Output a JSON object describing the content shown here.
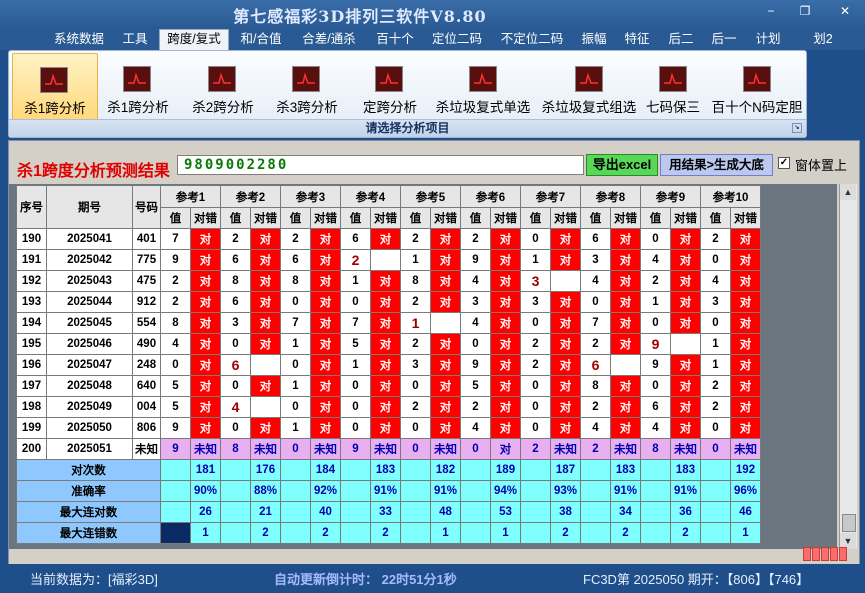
{
  "app_title": "第七感福彩3D排列三软件V8.80",
  "window_controls": [
    "−",
    "❐",
    "✕"
  ],
  "menu": [
    "系统数据",
    "工具",
    "跨度/复式",
    "和/合值",
    "合差/通杀",
    "百十个",
    "定位二码",
    "不定位二码",
    "振幅",
    "特征",
    "后二",
    "后一",
    "计划",
    "划2"
  ],
  "menu_active_index": 2,
  "ribbon": {
    "buttons": [
      "杀1跨分析",
      "杀1跨分析",
      "杀2跨分析",
      "杀3跨分析",
      "定跨分析",
      "杀垃圾复式单选",
      "杀垃圾复式组选",
      "七码保三",
      "百十个N码定胆"
    ],
    "selected_index": 0,
    "footer": "请选择分析项目"
  },
  "panel": {
    "result_title": "杀1跨度分析预测结果",
    "result_value": "9809002280",
    "export_label": "导出excel",
    "generate_label": "用结果>生成大底",
    "topmost_checked": "✓",
    "topmost_label": "窗体置上"
  },
  "grid": {
    "col_seq": "序号",
    "col_period": "期号",
    "col_number": "号码",
    "ref_groups": [
      "参考1",
      "参考2",
      "参考3",
      "参考4",
      "参考5",
      "参考6",
      "参考7",
      "参考8",
      "参考9",
      "参考10"
    ],
    "sub_value": "值",
    "sub_result": "对错",
    "rows": [
      {
        "seq": "190",
        "period": "2025041",
        "num": "401",
        "cells": [
          [
            "7",
            "对"
          ],
          [
            "2",
            "对"
          ],
          [
            "2",
            "对"
          ],
          [
            "6",
            "对"
          ],
          [
            "2",
            "对"
          ],
          [
            "2",
            "对"
          ],
          [
            "0",
            "对"
          ],
          [
            "6",
            "对"
          ],
          [
            "0",
            "对"
          ],
          [
            "2",
            "对"
          ]
        ]
      },
      {
        "seq": "191",
        "period": "2025042",
        "num": "775",
        "cells": [
          [
            "9",
            "对"
          ],
          [
            "6",
            "对"
          ],
          [
            "6",
            "对"
          ],
          [
            "2",
            ""
          ],
          [
            "1",
            "对"
          ],
          [
            "9",
            "对"
          ],
          [
            "1",
            "对"
          ],
          [
            "3",
            "对"
          ],
          [
            "4",
            "对"
          ],
          [
            "0",
            "对"
          ]
        ]
      },
      {
        "seq": "192",
        "period": "2025043",
        "num": "475",
        "cells": [
          [
            "2",
            "对"
          ],
          [
            "8",
            "对"
          ],
          [
            "8",
            "对"
          ],
          [
            "1",
            "对"
          ],
          [
            "8",
            "对"
          ],
          [
            "4",
            "对"
          ],
          [
            "3",
            ""
          ],
          [
            "4",
            "对"
          ],
          [
            "2",
            "对"
          ],
          [
            "4",
            "对"
          ]
        ]
      },
      {
        "seq": "193",
        "period": "2025044",
        "num": "912",
        "cells": [
          [
            "2",
            "对"
          ],
          [
            "6",
            "对"
          ],
          [
            "0",
            "对"
          ],
          [
            "0",
            "对"
          ],
          [
            "2",
            "对"
          ],
          [
            "3",
            "对"
          ],
          [
            "3",
            "对"
          ],
          [
            "0",
            "对"
          ],
          [
            "1",
            "对"
          ],
          [
            "3",
            "对"
          ]
        ]
      },
      {
        "seq": "194",
        "period": "2025045",
        "num": "554",
        "cells": [
          [
            "8",
            "对"
          ],
          [
            "3",
            "对"
          ],
          [
            "7",
            "对"
          ],
          [
            "7",
            "对"
          ],
          [
            "1",
            ""
          ],
          [
            "4",
            "对"
          ],
          [
            "0",
            "对"
          ],
          [
            "7",
            "对"
          ],
          [
            "0",
            "对"
          ],
          [
            "0",
            "对"
          ]
        ]
      },
      {
        "seq": "195",
        "period": "2025046",
        "num": "490",
        "cells": [
          [
            "4",
            "对"
          ],
          [
            "0",
            "对"
          ],
          [
            "1",
            "对"
          ],
          [
            "5",
            "对"
          ],
          [
            "2",
            "对"
          ],
          [
            "0",
            "对"
          ],
          [
            "2",
            "对"
          ],
          [
            "2",
            "对"
          ],
          [
            "9",
            ""
          ],
          [
            "1",
            "对"
          ]
        ]
      },
      {
        "seq": "196",
        "period": "2025047",
        "num": "248",
        "cells": [
          [
            "0",
            "对"
          ],
          [
            "6",
            ""
          ],
          [
            "0",
            "对"
          ],
          [
            "1",
            "对"
          ],
          [
            "3",
            "对"
          ],
          [
            "9",
            "对"
          ],
          [
            "2",
            "对"
          ],
          [
            "6",
            ""
          ],
          [
            "9",
            "对"
          ],
          [
            "1",
            "对"
          ]
        ]
      },
      {
        "seq": "197",
        "period": "2025048",
        "num": "640",
        "cells": [
          [
            "5",
            "对"
          ],
          [
            "0",
            "对"
          ],
          [
            "1",
            "对"
          ],
          [
            "0",
            "对"
          ],
          [
            "0",
            "对"
          ],
          [
            "5",
            "对"
          ],
          [
            "0",
            "对"
          ],
          [
            "8",
            "对"
          ],
          [
            "0",
            "对"
          ],
          [
            "2",
            "对"
          ]
        ]
      },
      {
        "seq": "198",
        "period": "2025049",
        "num": "004",
        "cells": [
          [
            "5",
            "对"
          ],
          [
            "4",
            ""
          ],
          [
            "0",
            "对"
          ],
          [
            "0",
            "对"
          ],
          [
            "2",
            "对"
          ],
          [
            "2",
            "对"
          ],
          [
            "0",
            "对"
          ],
          [
            "2",
            "对"
          ],
          [
            "6",
            "对"
          ],
          [
            "2",
            "对"
          ]
        ]
      },
      {
        "seq": "199",
        "period": "2025050",
        "num": "806",
        "cells": [
          [
            "9",
            "对"
          ],
          [
            "0",
            "对"
          ],
          [
            "1",
            "对"
          ],
          [
            "0",
            "对"
          ],
          [
            "0",
            "对"
          ],
          [
            "4",
            "对"
          ],
          [
            "0",
            "对"
          ],
          [
            "4",
            "对"
          ],
          [
            "4",
            "对"
          ],
          [
            "0",
            "对"
          ]
        ]
      }
    ],
    "miss_marks": [
      [
        1,
        3
      ],
      [
        2,
        6
      ],
      [
        4,
        4
      ],
      [
        5,
        8
      ],
      [
        6,
        1
      ],
      [
        6,
        7
      ],
      [
        8,
        1
      ]
    ],
    "unknown_row": {
      "seq": "200",
      "period": "2025051",
      "num": "未知",
      "cells": [
        [
          "9",
          "未知"
        ],
        [
          "8",
          "未知"
        ],
        [
          "0",
          "未知"
        ],
        [
          "9",
          "未知"
        ],
        [
          "0",
          "未知"
        ],
        [
          "0",
          "对"
        ],
        [
          "2",
          "未知"
        ],
        [
          "2",
          "未知"
        ],
        [
          "8",
          "未知"
        ],
        [
          "0",
          "未知"
        ]
      ]
    },
    "stats": [
      {
        "label": "对次数",
        "values": [
          "181",
          "176",
          "184",
          "183",
          "182",
          "189",
          "187",
          "183",
          "183",
          "192"
        ]
      },
      {
        "label": "准确率",
        "values": [
          "90%",
          "88%",
          "92%",
          "91%",
          "91%",
          "94%",
          "93%",
          "91%",
          "91%",
          "96%"
        ]
      },
      {
        "label": "最大连对数",
        "values": [
          "26",
          "21",
          "40",
          "33",
          "48",
          "53",
          "38",
          "34",
          "36",
          "46"
        ]
      },
      {
        "label": "最大连错数",
        "values": [
          "1",
          "2",
          "2",
          "2",
          "1",
          "1",
          "2",
          "2",
          "2",
          "1"
        ]
      }
    ]
  },
  "status": {
    "current_data": "当前数据为：[福彩3D]",
    "countdown": "自动更新倒计时：  22时51分1秒",
    "draw_info": "FC3D第 2025050 期开：【806】【746】"
  },
  "colors": {
    "hit": "#ff0000",
    "unknown": "#e8b0f0",
    "stat": "#80ffff",
    "accent": "#1e4f8a"
  }
}
